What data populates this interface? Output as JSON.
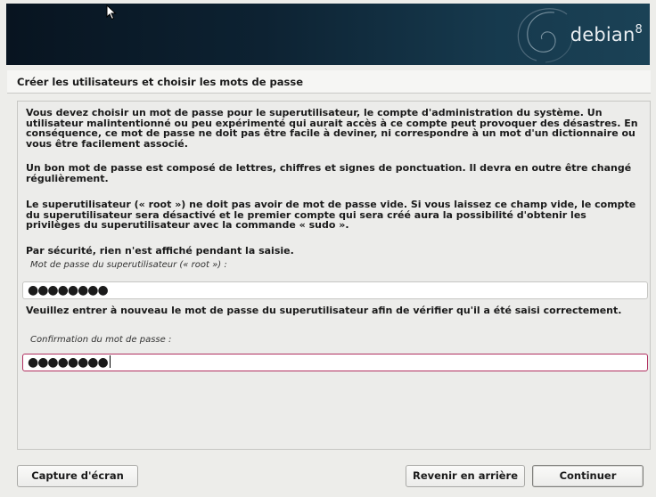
{
  "banner": {
    "brand": "debian",
    "version": "8"
  },
  "page": {
    "title": "Créer les utilisateurs et choisir les mots de passe"
  },
  "content": {
    "para1": "Vous devez choisir un mot de passe pour le superutilisateur, le compte d'administration du système. Un utilisateur malintentionné ou peu expérimenté qui aurait accès à ce compte peut provoquer des désastres. En conséquence, ce mot de passe ne doit pas être facile à deviner, ni correspondre à un mot d'un dictionnaire ou vous être facilement associé.",
    "para2": "Un bon mot de passe est composé de lettres, chiffres et signes de ponctuation. Il devra en outre être changé régulièrement.",
    "para3": "Le superutilisateur (« root ») ne doit pas avoir de mot de passe vide. Si vous laissez ce champ vide, le compte du superutilisateur sera désactivé et le premier compte qui sera créé aura la possibilité d'obtenir les privilèges du superutilisateur avec la commande « sudo ».",
    "para4": "Par sécurité, rien n'est affiché pendant la saisie.",
    "password_label": "Mot de passe du superutilisateur (« root ») :",
    "password_value": "●●●●●●●●",
    "confirm_prompt": "Veuillez entrer à nouveau le mot de passe du superutilisateur afin de vérifier qu'il a été saisi correctement.",
    "confirm_label": "Confirmation du mot de passe :",
    "confirm_value": "●●●●●●●●"
  },
  "buttons": {
    "screenshot": "Capture d'écran",
    "back": "Revenir en arrière",
    "continue": "Continuer"
  },
  "colors": {
    "banner_dark": "#081420",
    "focus_border": "#b02f5f"
  }
}
